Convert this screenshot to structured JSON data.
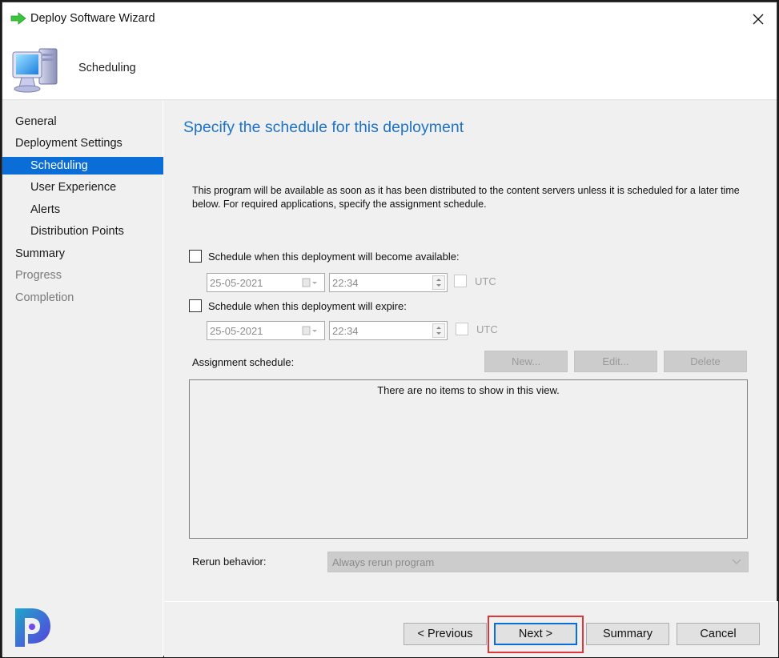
{
  "window": {
    "title": "Deploy Software Wizard",
    "title_icon": "green-arrow-icon",
    "close_icon": "close-icon"
  },
  "header": {
    "title": "Scheduling",
    "icon": "computer-icon"
  },
  "sidebar": {
    "items": [
      {
        "label": "General",
        "level": 0,
        "state": "normal"
      },
      {
        "label": "Deployment Settings",
        "level": 0,
        "state": "normal"
      },
      {
        "label": "Scheduling",
        "level": 1,
        "state": "active"
      },
      {
        "label": "User Experience",
        "level": 1,
        "state": "normal"
      },
      {
        "label": "Alerts",
        "level": 1,
        "state": "normal"
      },
      {
        "label": "Distribution Points",
        "level": 1,
        "state": "normal"
      },
      {
        "label": "Summary",
        "level": 0,
        "state": "normal"
      },
      {
        "label": "Progress",
        "level": 0,
        "state": "disabled"
      },
      {
        "label": "Completion",
        "level": 0,
        "state": "disabled"
      }
    ],
    "active_color": "#0a6dd8"
  },
  "main": {
    "page_title": "Specify the schedule for this deployment",
    "page_title_color": "#1e73c8",
    "description": "This program will be available as soon as it has been distributed to the content servers unless it is scheduled for a later time below. For required applications, specify the assignment schedule.",
    "available": {
      "label": "Schedule when this deployment will become available:",
      "checked": false,
      "date": "25-05-2021",
      "time": "22:34",
      "utc_label": "UTC",
      "utc_checked": false
    },
    "expire": {
      "label": "Schedule when this deployment will expire:",
      "checked": false,
      "date": "25-05-2021",
      "time": "22:34",
      "utc_label": "UTC",
      "utc_checked": false
    },
    "assignment": {
      "label": "Assignment schedule:",
      "buttons": {
        "new": "New...",
        "edit": "Edit...",
        "delete": "Delete"
      },
      "empty_text": "There are no items to show in this view."
    },
    "rerun": {
      "label": "Rerun behavior:",
      "selected": "Always rerun program"
    }
  },
  "footer": {
    "previous": "< Previous",
    "next": "Next >",
    "summary": "Summary",
    "cancel": "Cancel",
    "highlight_color": "#e0353a"
  }
}
